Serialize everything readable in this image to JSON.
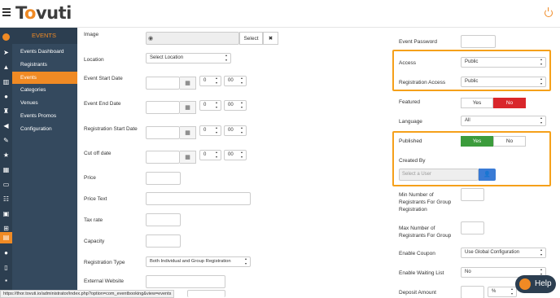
{
  "brand": {
    "logo_prefix": "T",
    "logo_o": "o",
    "logo_suffix": "vuti"
  },
  "sidebar": {
    "title": "EVENTS",
    "items": [
      {
        "label": "Events Dashboard",
        "active": false
      },
      {
        "label": "Registrants",
        "active": false
      },
      {
        "label": "Events",
        "active": true
      },
      {
        "label": "Categories",
        "active": false
      },
      {
        "label": "Venues",
        "active": false
      },
      {
        "label": "Events Promos",
        "active": false
      },
      {
        "label": "Configuration",
        "active": false
      }
    ]
  },
  "form_left": {
    "image": {
      "label": "Image",
      "select_label": "Select",
      "clear_label": "✖"
    },
    "location": {
      "label": "Location",
      "value": "Select Location"
    },
    "start_date": {
      "label": "Event Start Date",
      "hour": "0",
      "minute": "00"
    },
    "end_date": {
      "label": "Event End Date",
      "hour": "0",
      "minute": "00"
    },
    "reg_start": {
      "label": "Registration Start Date",
      "hour": "0",
      "minute": "00"
    },
    "cutoff": {
      "label": "Cut off date",
      "hour": "0",
      "minute": "00"
    },
    "price": {
      "label": "Price"
    },
    "price_text": {
      "label": "Price Text"
    },
    "tax_rate": {
      "label": "Tax rate"
    },
    "capacity": {
      "label": "Capacity"
    },
    "registration_type": {
      "label": "Registration Type",
      "value": "Both Individual and Group Registration"
    },
    "external_website": {
      "label": "External Website"
    }
  },
  "form_right": {
    "event_password": {
      "label": "Event Password"
    },
    "access": {
      "label": "Access",
      "value": "Public"
    },
    "registration_access": {
      "label": "Registration Access",
      "value": "Public"
    },
    "featured": {
      "label": "Featured",
      "yes": "Yes",
      "no": "No",
      "selected": "No"
    },
    "language": {
      "label": "Language",
      "value": "All"
    },
    "published": {
      "label": "Published",
      "yes": "Yes",
      "no": "No",
      "selected": "Yes"
    },
    "created_by": {
      "label": "Created By",
      "placeholder": "Select a User"
    },
    "min_registrants": {
      "label_l1": "Min Number of",
      "label_l2": "Registrants For Group",
      "label_l3": "Registration"
    },
    "max_registrants": {
      "label_l1": "Max Number of",
      "label_l2": "Registrants For Group"
    },
    "enable_coupon": {
      "label": "Enable Coupon",
      "value": "Use Global Configuration"
    },
    "enable_waiting_list": {
      "label": "Enable Waiting List",
      "value": "No"
    },
    "deposit_amount": {
      "label": "Deposit Amount",
      "unit": "%"
    }
  },
  "statusbar": {
    "url": "https://thor.tovuti.io/administrator/index.php?option=com_eventbooking&view=events"
  },
  "help": {
    "label": "Help"
  },
  "colors": {
    "accent": "#f08a24",
    "sidebar": "#34495e",
    "rail": "#2c3e50",
    "green": "#3c9c3c",
    "red": "#d9262b"
  }
}
